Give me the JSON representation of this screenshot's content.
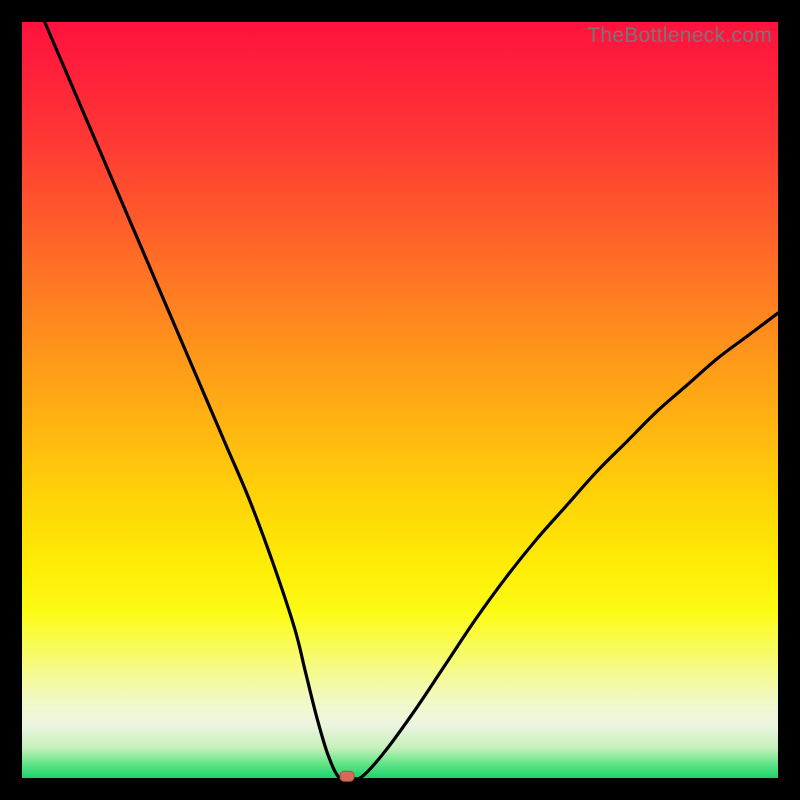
{
  "watermark": "TheBottleneck.com",
  "chart_data": {
    "type": "line",
    "title": "",
    "xlabel": "",
    "ylabel": "",
    "xlim": [
      0,
      100
    ],
    "ylim": [
      0,
      100
    ],
    "x": [
      3,
      6,
      9,
      12,
      15,
      18,
      21,
      24,
      27,
      30,
      33,
      36,
      37.5,
      39,
      40.5,
      42,
      43.5,
      45,
      48,
      52,
      56,
      60,
      64,
      68,
      72,
      76,
      80,
      84,
      88,
      92,
      96,
      100
    ],
    "values": [
      100,
      93,
      86,
      79,
      72,
      65,
      58,
      51,
      44,
      37,
      29,
      20,
      14,
      8,
      3,
      0,
      0,
      0.2,
      3.5,
      9,
      15,
      21,
      26.5,
      31.5,
      36,
      40.5,
      44.5,
      48.5,
      52,
      55.5,
      58.5,
      61.5
    ],
    "marker": {
      "x": 43,
      "y": 0.1
    }
  },
  "colors": {
    "curve": "#000000",
    "marker_fill": "#d66a5a",
    "marker_stroke": "#b94e3f"
  }
}
